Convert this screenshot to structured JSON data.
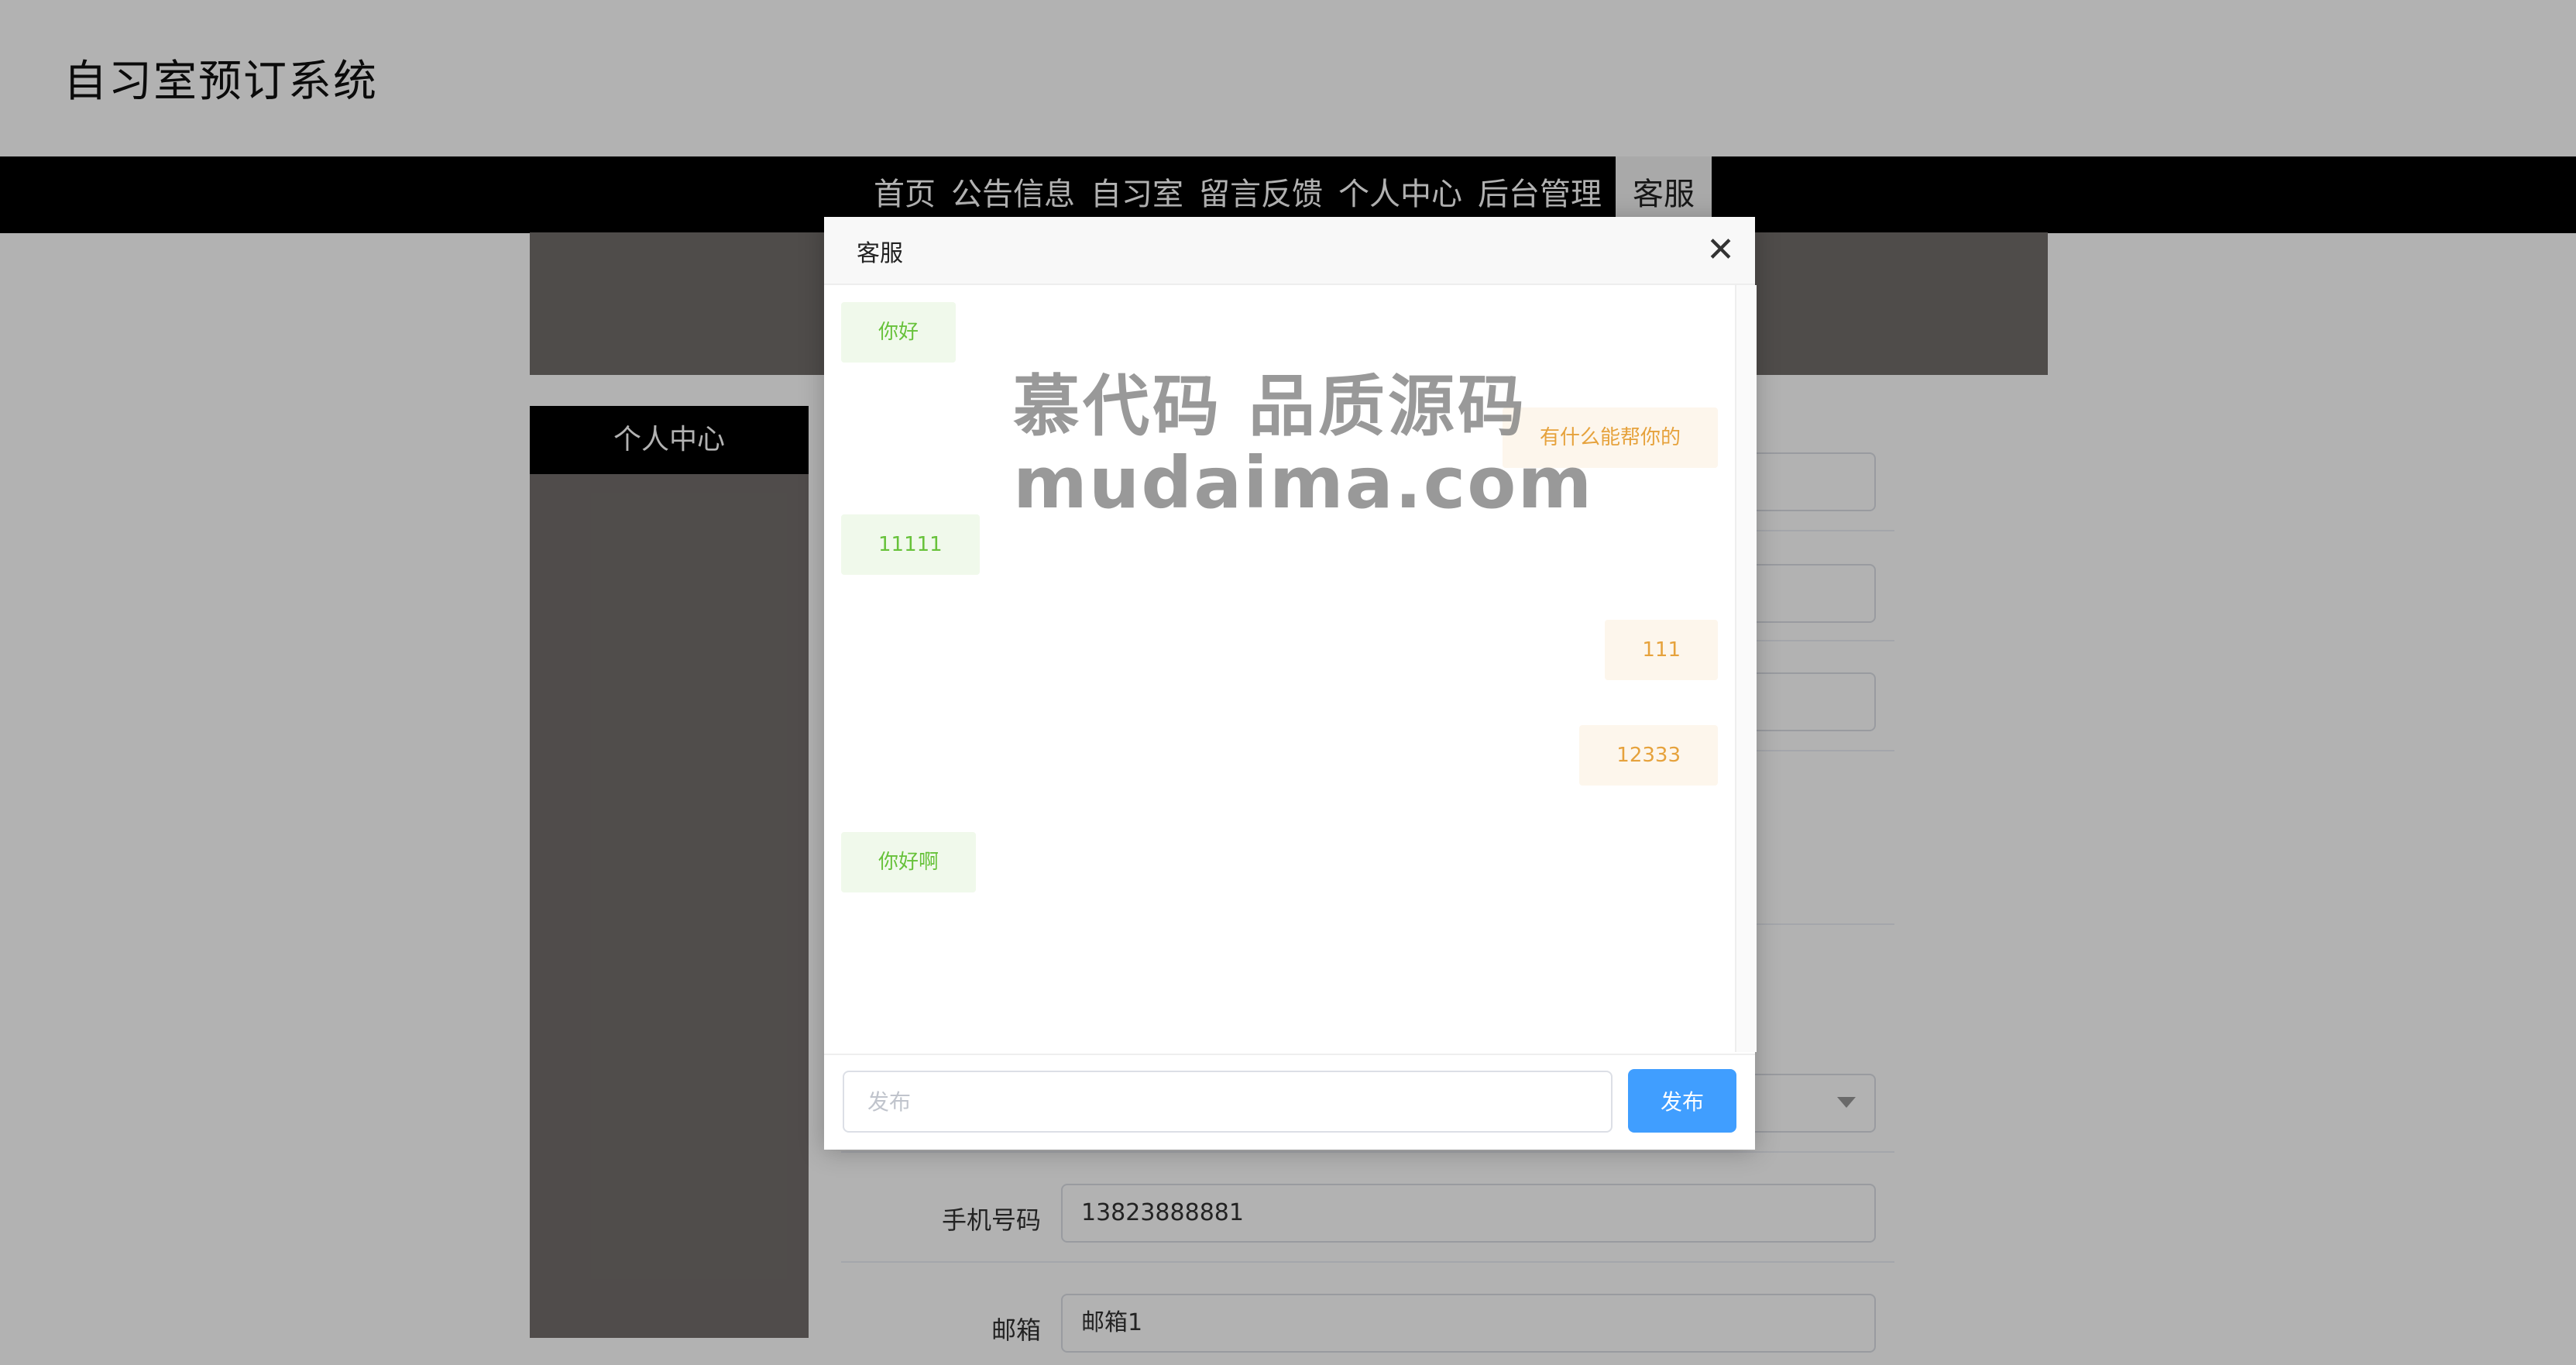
{
  "site": {
    "title": "自习室预订系统"
  },
  "nav": {
    "items": [
      "首页",
      "公告信息",
      "自习室",
      "留言反馈",
      "个人中心",
      "后台管理"
    ],
    "active": "客服"
  },
  "sidebar": {
    "title": "个人中心"
  },
  "form": {
    "phone_label": "手机号码",
    "phone_value": "13823888881",
    "email_label": "邮箱",
    "email_value": "邮箱1"
  },
  "dialog": {
    "title": "客服",
    "close_icon": "close-icon",
    "messages": [
      {
        "side": "left",
        "text": "你好"
      },
      {
        "side": "right",
        "text": "有什么能帮你的"
      },
      {
        "side": "left",
        "text": "11111"
      },
      {
        "side": "right",
        "text": "111"
      },
      {
        "side": "right",
        "text": "12333"
      },
      {
        "side": "left",
        "text": "你好啊"
      }
    ],
    "input_placeholder": "发布",
    "send_label": "发布"
  },
  "watermark": {
    "line1": "慕代码 品质源码",
    "line2": "mudaima.com"
  },
  "colors": {
    "accent": "#409eff",
    "left_bubble_bg": "#f0f9eb",
    "left_bubble_text": "#67c23a",
    "right_bubble_bg": "#fdf6ec",
    "right_bubble_text": "#e6a23c"
  }
}
